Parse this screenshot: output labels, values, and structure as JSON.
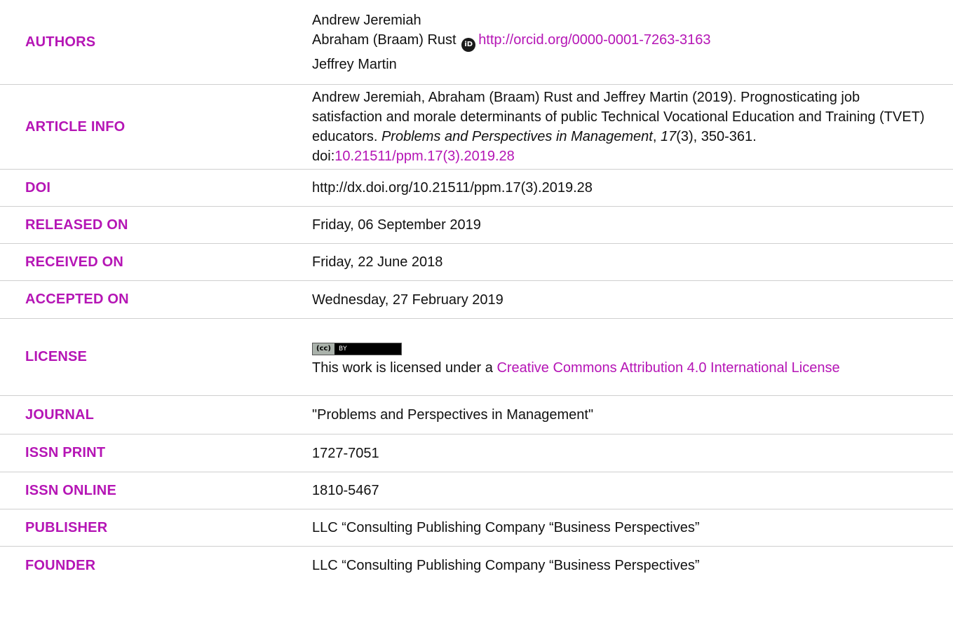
{
  "rows": {
    "authors": {
      "label": "AUTHORS",
      "names": [
        "Andrew Jeremiah",
        "Abraham (Braam) Rust",
        "Jeffrey Martin"
      ],
      "orcid_icon_text": "iD",
      "orcid_url": "http://orcid.org/0000-0001-7263-3163"
    },
    "article_info": {
      "label": "ARTICLE INFO",
      "citation_prefix": "Andrew Jeremiah, Abraham (Braam) Rust and Jeffrey Martin (2019). Prognosticating job satisfaction and morale determinants of public Technical Vocational Education and Training (TVET) educators. ",
      "journal_italic": "Problems and Perspectives in Management",
      "sep": ", ",
      "volume_italic": "17",
      "issue_pages": "(3), 350-361. doi:",
      "doi_link": "10.21511/ppm.17(3).2019.28"
    },
    "doi": {
      "label": "DOI",
      "value": "http://dx.doi.org/10.21511/ppm.17(3).2019.28"
    },
    "released_on": {
      "label": "RELEASED ON",
      "value": "Friday, 06 September 2019"
    },
    "received_on": {
      "label": "RECEIVED ON",
      "value": "Friday, 22 June 2018"
    },
    "accepted_on": {
      "label": "ACCEPTED ON",
      "value": "Wednesday, 27 February 2019"
    },
    "license": {
      "label": "LICENSE",
      "badge_cc": "(cc)",
      "badge_by": "BY",
      "text_prefix": "This work is licensed under a ",
      "link_text": "Creative Commons Attribution 4.0 International License"
    },
    "journal": {
      "label": "JOURNAL",
      "value": "\"Problems and Perspectives in Management\""
    },
    "issn_print": {
      "label": "ISSN PRINT",
      "value": "1727-7051"
    },
    "issn_online": {
      "label": "ISSN ONLINE",
      "value": "1810-5467"
    },
    "publisher": {
      "label": "PUBLISHER",
      "value": "LLC “Consulting Publishing Company “Business Perspectives”"
    },
    "founder": {
      "label": "FOUNDER",
      "value": "LLC “Consulting Publishing Company “Business Perspectives”"
    }
  },
  "colors": {
    "label": "#b515b5",
    "link": "#b515b5",
    "text": "#111111",
    "divider": "#cfcfcf"
  }
}
